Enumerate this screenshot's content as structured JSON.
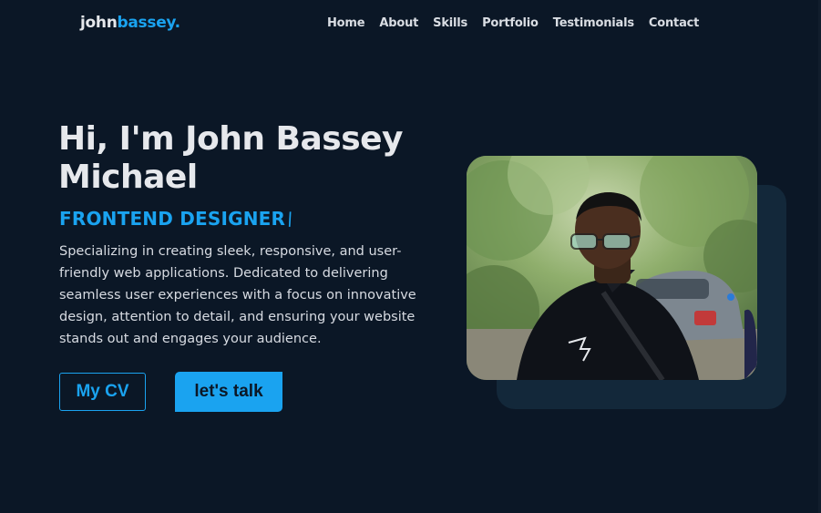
{
  "logo": {
    "first": "john",
    "last": "bassey."
  },
  "nav": {
    "items": [
      "Home",
      "About",
      "Skills",
      "Portfolio",
      "Testimonials",
      "Contact"
    ]
  },
  "hero": {
    "title": "Hi, I'm John Bassey Michael",
    "role": "FRONTEND DESIGNER",
    "caret": "\\",
    "description": "Specializing in creating sleek, responsive, and user-friendly web applications. Dedicated to delivering seamless user experiences with a focus on innovative design, attention to detail, and ensuring your website stands out and engages your audience.",
    "cv_button": "My CV",
    "talk_button": "let's talk"
  },
  "colors": {
    "background": "#0b1726",
    "accent": "#1aa3f0",
    "text": "#e6e8ec"
  }
}
